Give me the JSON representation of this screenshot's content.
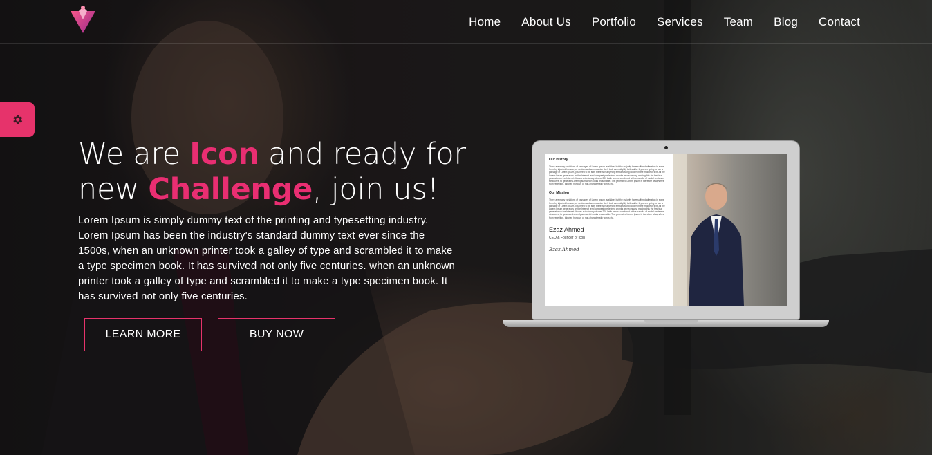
{
  "brand": {
    "accent_color": "#e6336b",
    "logo_icon": "diamond-heart-logo-icon"
  },
  "nav": {
    "items": [
      "Home",
      "About Us",
      "Portfolio",
      "Services",
      "Team",
      "Blog",
      "Contact"
    ]
  },
  "settings": {
    "icon": "gear-icon"
  },
  "hero": {
    "headline_part1": "We are ",
    "headline_highlight1": "Icon",
    "headline_part2": " and ready for new ",
    "headline_highlight2": "Challenge",
    "headline_part3": ", join us!",
    "paragraph": "Lorem Ipsum is simply dummy text of the printing and typesetting industry. Lorem Ipsum has been the industry's standard dummy text ever since the 1500s, when an unknown printer took a galley of type and scrambled it to make a type specimen book. It has survived not only five centuries. when an unknown printer took a galley of type and scrambled it to make a type specimen book. It has survived not only five centuries.",
    "learn_more_label": "LEARN MORE",
    "buy_now_label": "BUY NOW"
  },
  "laptop_screen": {
    "history_heading": "Our History",
    "history_text": "There are many variations of passages of Lorem Ipsum available, but the majority have suffered alteration in some form, by injected humour, or randomised words which don't look even slightly believable. If you are going to use a passage of Lorem Ipsum, you need to be sure there isn't anything embarrassing hidden in the middle of text. All the Lorem Ipsum generators on the Internet tend to repeat predefined chunks as necessary, making this the first true generator on the Internet. It uses a dictionary of over 200 Latin words, combined with a handful of model sentence structures, to generate Lorem Ipsum which looks reasonable. The generated Lorem Ipsum is therefore always free from repetition, injected humour, or non-characteristic words etc.",
    "mission_heading": "Our Mission",
    "mission_text": "There are many variations of passages of Lorem Ipsum available, but the majority have suffered alteration in some form, by injected humour, or randomised words which don't look even slightly believable. If you are going to use a passage of Lorem Ipsum, you need to be sure there isn't anything embarrassing hidden in the middle of text. All the Lorem Ipsum generators on the Internet tend to repeat predefined chunks as necessary, making this the first true generator on the Internet. It uses a dictionary of over 200 Latin words, combined with a handful of model sentence structures, to generate Lorem Ipsum which looks reasonable. The generated Lorem Ipsum is therefore always free from repetition, injected humour, or non-characteristic words etc.",
    "person_name": "Ezaz Ahmed",
    "person_role": "CEO & Founder of Icon",
    "signature": "Ezaz Ahmed"
  }
}
